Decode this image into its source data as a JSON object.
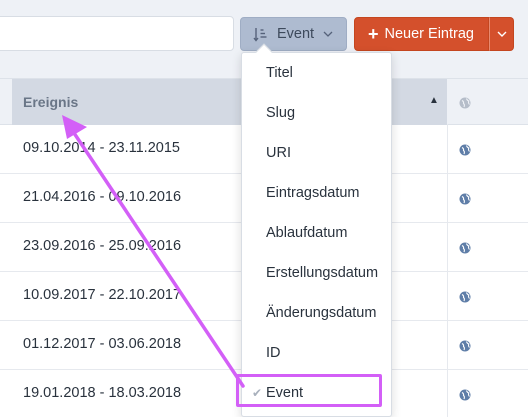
{
  "toolbar": {
    "sort_label": "Event",
    "new_entry_label": "Neuer Eintrag"
  },
  "table": {
    "column_header": "Ereignis",
    "rows": [
      {
        "date_range": "09.10.2014 - 23.11.2015"
      },
      {
        "date_range": "21.04.2016 - 09.10.2016"
      },
      {
        "date_range": "23.09.2016 - 25.09.2016"
      },
      {
        "date_range": "10.09.2017 - 22.10.2017"
      },
      {
        "date_range": "01.12.2017 - 03.06.2018"
      },
      {
        "date_range": "19.01.2018 - 18.03.2018"
      }
    ]
  },
  "sort_menu": {
    "items": [
      {
        "label": "Titel"
      },
      {
        "label": "Slug"
      },
      {
        "label": "URI"
      },
      {
        "label": "Eintragsdatum"
      },
      {
        "label": "Ablaufdatum"
      },
      {
        "label": "Erstellungsdatum"
      },
      {
        "label": "Änderungsdatum"
      },
      {
        "label": "ID"
      },
      {
        "label": "Event"
      }
    ],
    "selected_index": 8
  },
  "colors": {
    "accent_red": "#d4502c",
    "sort_button_bg": "#aebbd0",
    "annotation_magenta": "#d35ff7",
    "globe_blue": "#5f7ea8"
  }
}
